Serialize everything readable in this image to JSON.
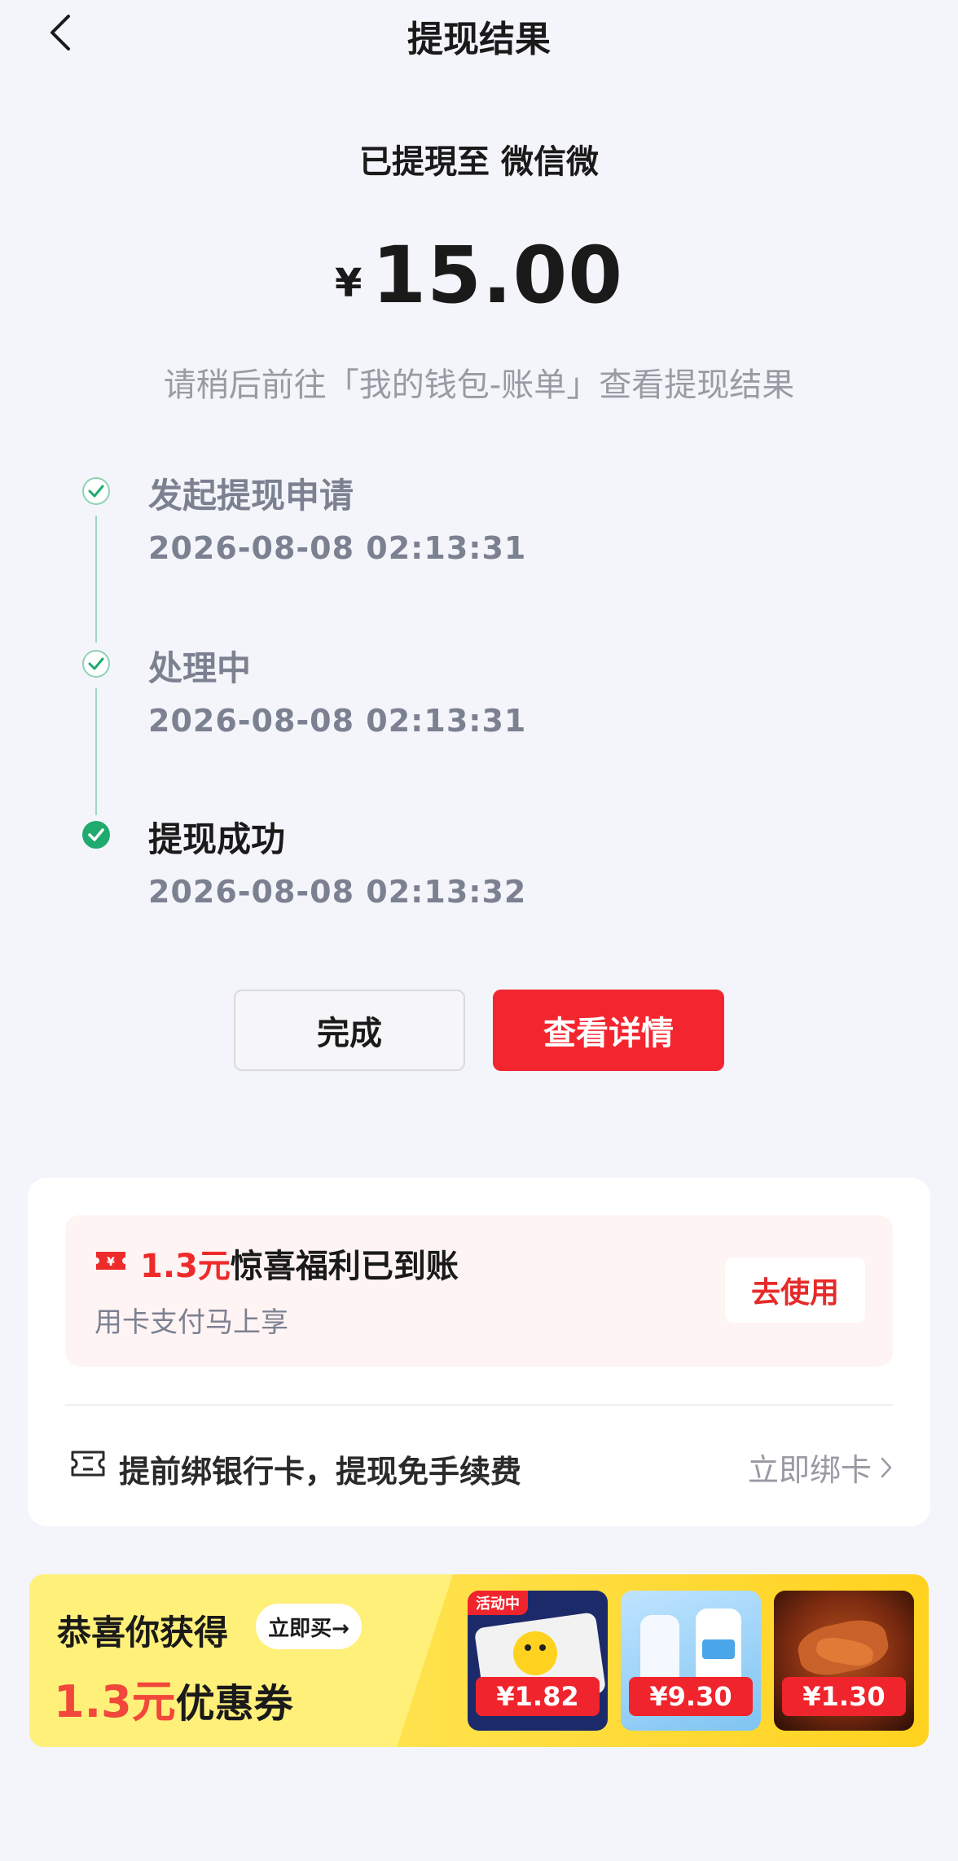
{
  "header": {
    "title": "提现结果"
  },
  "summary": {
    "destination": "已提現至 微信微",
    "currency": "¥",
    "amount": "15.00",
    "hint": "请稍后前往「我的钱包-账单」查看提现结果"
  },
  "timeline": [
    {
      "title": "发起提现申请",
      "time": "2026-08-08 02:13:31"
    },
    {
      "title": "处理中",
      "time": "2026-08-08 02:13:31"
    },
    {
      "title": "提现成功",
      "time": "2026-08-08 02:13:32"
    }
  ],
  "buttons": {
    "done": "完成",
    "detail": "查看详情"
  },
  "coupon": {
    "amount": "1.3元",
    "title": "惊喜福利已到账",
    "subtitle": "用卡支付马上享",
    "use_label": "去使用"
  },
  "bind_card": {
    "text": "提前绑银行卡，提现免手续费",
    "link": "立即绑卡"
  },
  "banner": {
    "title": "恭喜你获得",
    "buy_label": "立即买→",
    "amount": "1.3元",
    "amount_suffix": "优惠券",
    "products": [
      {
        "price": "¥1.82",
        "tag": "活动中"
      },
      {
        "price": "¥9.30"
      },
      {
        "price": "¥1.30"
      }
    ]
  },
  "colors": {
    "accent_red": "#f3262f",
    "success_green": "#1faa6e",
    "banner_yellow": "#ffe14a"
  },
  "icons": {
    "back": "chevron-left-icon",
    "step_done": "check-circle-icon",
    "coupon": "ticket-icon",
    "bind": "card-icon",
    "link": "chevron-right-icon"
  }
}
